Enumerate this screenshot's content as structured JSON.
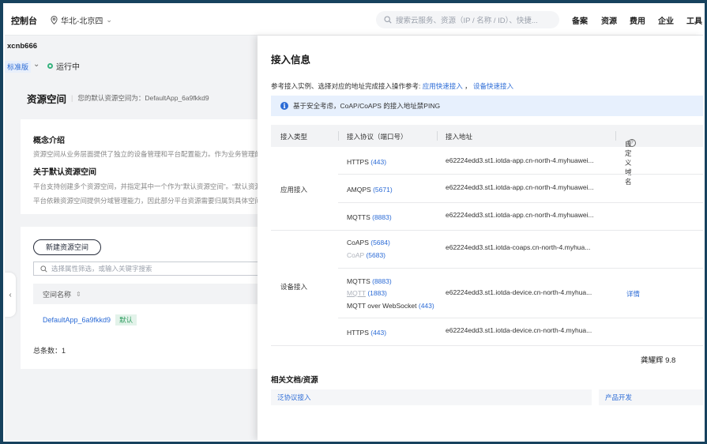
{
  "topbar": {
    "title": "控制台",
    "region": "华北-北京四",
    "search_placeholder": "搜索云服务、资源（IP / 名称 / ID）、快捷...",
    "nav": [
      "备案",
      "资源",
      "费用",
      "企业",
      "工具"
    ]
  },
  "instance": {
    "name": "xcnb666",
    "edition": "标准版",
    "status": "运行中"
  },
  "resource_space": {
    "title": "资源空间",
    "subtitle": "您的默认资源空间为：DefaultApp_6a9fkkd9",
    "intro_title": "概念介绍",
    "intro_text": "资源空间从业务层面提供了独立的设备管理和平台配置能力。作为业务管理的",
    "default_title": "关于默认资源空间",
    "default_text_1": "平台支持创建多个资源空间，并指定其中一个作为“默认资源空间”。“默认资源",
    "default_text_2": "平台依赖资源空间提供分域管理能力，因此部分平台资源需要归属到具体空间",
    "new_button": "新建资源空间",
    "filter_placeholder": "选择属性筛选，或输入关键字搜索",
    "col_name": "空间名称",
    "row_name": "DefaultApp_6a9fkkd9",
    "row_badge": "默认",
    "total": "总条数：1"
  },
  "drawer": {
    "title": "接入信息",
    "desc_prefix": "参考接入实例、选择对应的地址完成接入操作参考:",
    "desc_link1": "应用快速接入",
    "desc_sep": "，",
    "desc_link2": "设备快速接入",
    "alert": "基于安全考虑，CoAP/CoAPS 的接入地址禁PING",
    "headers": {
      "type": "接入类型",
      "protocol": "接入协议（端口号）",
      "address": "接入地址",
      "domain": "自定义域名"
    },
    "app_type": "应用接入",
    "device_type": "设备接入",
    "app_rows": [
      {
        "proto": "HTTPS",
        "port": "(443)",
        "addr": "e62224edd3.st1.iotda-app.cn-north-4.myhuawei..."
      },
      {
        "proto": "AMQPS",
        "port": "(5671)",
        "addr": "e62224edd3.st1.iotda-app.cn-north-4.myhuawei..."
      },
      {
        "proto": "MQTTS",
        "port": "(8883)",
        "addr": "e62224edd3.st1.iotda-app.cn-north-4.myhuawei..."
      }
    ],
    "coaps": {
      "proto": "CoAPS",
      "port": "(5684)",
      "proto2": "CoAP",
      "port2": "(5683)",
      "addr": "e62224edd3.st1.iotda-coaps.cn-north-4.myhua..."
    },
    "mqtt": {
      "proto": "MQTTS",
      "port": "(8883)",
      "proto2": "MQTT",
      "port2": "(1883)",
      "proto3": "MQTT over WebSocket",
      "port3": "(443)",
      "addr": "e62224edd3.st1.iotda-device.cn-north-4.myhua...",
      "detail": "详情"
    },
    "https_dev": {
      "proto": "HTTPS",
      "port": "(443)",
      "addr": "e62224edd3.st1.iotda-device.cn-north-4.myhua..."
    },
    "watermark": "龚耀辉 9.8",
    "docs_title": "相关文档/资源",
    "doc1": "泛协议接入",
    "doc2": "产品开发"
  },
  "colors": {
    "accent": "#2b6bd6",
    "status_green": "#36b37e",
    "frame_bg": "#17425e"
  }
}
